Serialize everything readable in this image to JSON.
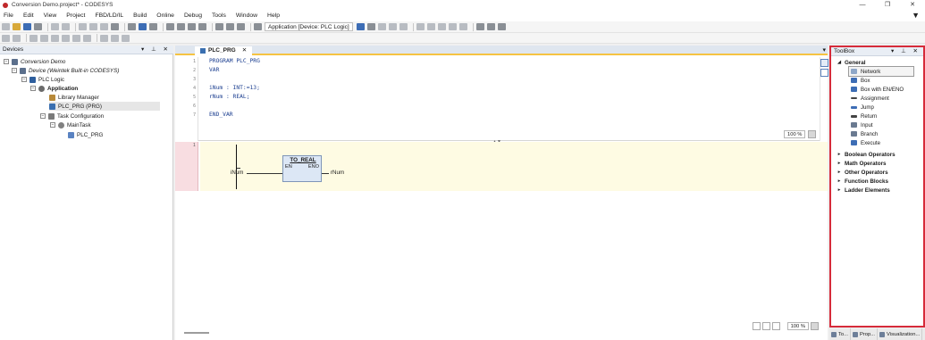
{
  "window": {
    "title": "Conversion Demo.project* - CODESYS",
    "controls": [
      "—",
      "❐",
      "✕"
    ]
  },
  "menu": [
    "File",
    "Edit",
    "View",
    "Project",
    "FBD/LD/IL",
    "Build",
    "Online",
    "Debug",
    "Tools",
    "Window",
    "Help"
  ],
  "menu_filter_icon": "filter-icon",
  "toolbar": {
    "active_application": "Application [Device: PLC Logic]"
  },
  "devices": {
    "header": "Devices",
    "tree": [
      {
        "label": "Conversion Demo",
        "level": 0,
        "icon": "project-icon",
        "expander": "−"
      },
      {
        "label": "Device (Weintek Built-in CODESYS)",
        "level": 1,
        "icon": "device-icon",
        "expander": "−"
      },
      {
        "label": "PLC Logic",
        "level": 2,
        "icon": "plc-icon",
        "expander": "−"
      },
      {
        "label": "Application",
        "level": 3,
        "icon": "application-icon",
        "expander": "−"
      },
      {
        "label": "Library Manager",
        "level": 4,
        "icon": "library-icon",
        "expander": ""
      },
      {
        "label": "PLC_PRG (PRG)",
        "level": 4,
        "icon": "program-icon",
        "expander": ""
      },
      {
        "label": "Task Configuration",
        "level": 4,
        "icon": "task-config-icon",
        "expander": "−"
      },
      {
        "label": "MainTask",
        "level": 5,
        "icon": "gear-icon",
        "expander": "−"
      },
      {
        "label": "PLC_PRG",
        "level": 6,
        "icon": "program-call-icon",
        "expander": ""
      }
    ]
  },
  "editor": {
    "tab_label": "PLC_PRG",
    "tab_close": "✕",
    "declaration": {
      "lines": [
        {
          "num": "1",
          "text": "PROGRAM PLC_PRG"
        },
        {
          "num": "2",
          "text": "VAR"
        },
        {
          "num": "3",
          "text": ""
        },
        {
          "num": "4",
          "text": "iNum : INT:=13;"
        },
        {
          "num": "5",
          "text": "rNum : REAL;"
        },
        {
          "num": "6",
          "text": ""
        },
        {
          "num": "7",
          "text": "END_VAR"
        }
      ],
      "zoom": "100 %"
    },
    "network": {
      "number": "1",
      "block_name": "TO_REAL",
      "pin_en": "EN",
      "pin_eno": "ENO",
      "input_var": "iNum",
      "output_var": "rNum"
    },
    "bottom_zoom": "100 %"
  },
  "toolbox": {
    "header": "ToolBox",
    "sections": [
      {
        "label": "General",
        "expanded": true
      },
      {
        "label": "Boolean Operators",
        "expanded": false
      },
      {
        "label": "Math Operators",
        "expanded": false
      },
      {
        "label": "Other Operators",
        "expanded": false
      },
      {
        "label": "Function Blocks",
        "expanded": false
      },
      {
        "label": "Ladder Elements",
        "expanded": false
      }
    ],
    "general_items": [
      {
        "label": "Network",
        "icon": "network-icon"
      },
      {
        "label": "Box",
        "icon": "box-icon"
      },
      {
        "label": "Box with EN/ENO",
        "icon": "box-en-eno-icon"
      },
      {
        "label": "Assignment",
        "icon": "assignment-icon"
      },
      {
        "label": "Jump",
        "icon": "jump-icon"
      },
      {
        "label": "Return",
        "icon": "return-icon"
      },
      {
        "label": "Input",
        "icon": "input-icon"
      },
      {
        "label": "Branch",
        "icon": "branch-icon"
      },
      {
        "label": "Execute",
        "icon": "execute-icon"
      }
    ]
  },
  "bottom_tabs": [
    "To...",
    "Prop...",
    "Visualization..."
  ],
  "colors": {
    "toolbox_highlight": "#d62b3a",
    "network_body": "#fefbe3",
    "network_gutter": "#f8dde1",
    "fb_box": "#dce7f5"
  }
}
